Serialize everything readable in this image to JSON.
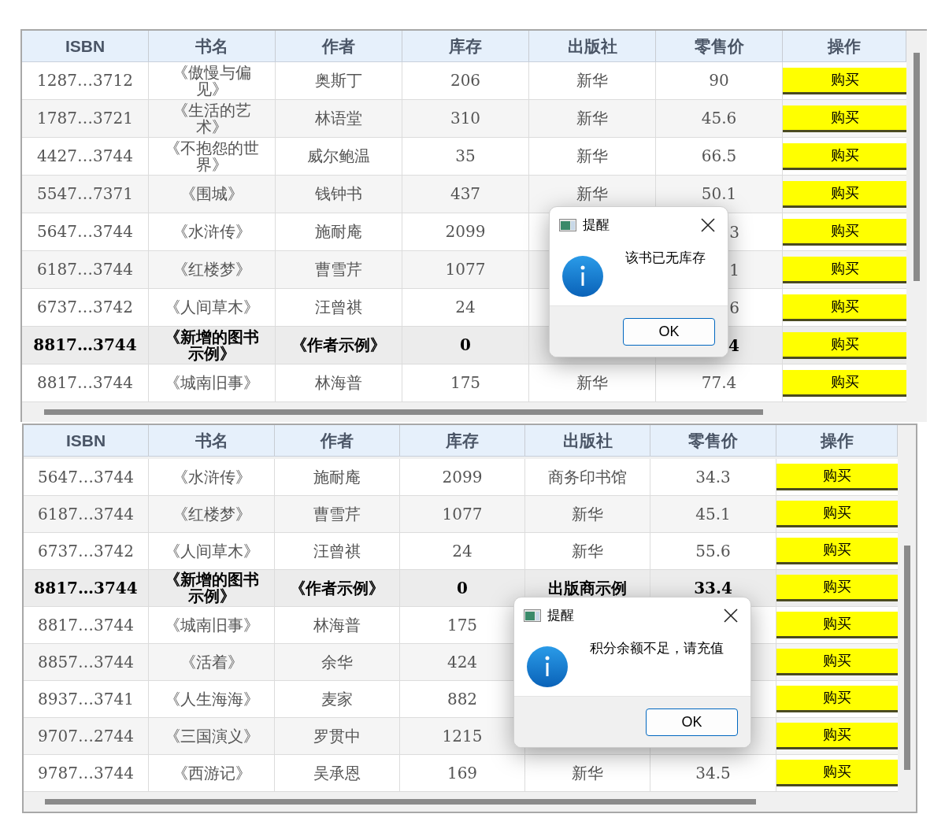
{
  "panels": [
    {
      "columns": [
        "ISBN",
        "书名",
        "作者",
        "库存",
        "出版社",
        "零售价",
        "操作"
      ],
      "rows": [
        {
          "isbn": "1287…3712",
          "title": "《傲慢与偏见》",
          "author": "奥斯丁",
          "stock": "206",
          "publisher": "新华",
          "price": "90",
          "button": "购买",
          "selected": false
        },
        {
          "isbn": "1787…3721",
          "title": "《生活的艺术》",
          "author": "林语堂",
          "stock": "310",
          "publisher": "新华",
          "price": "45.6",
          "button": "购买",
          "selected": false
        },
        {
          "isbn": "4427…3744",
          "title": "《不抱怨的世界》",
          "author": "威尔鲍温",
          "stock": "35",
          "publisher": "新华",
          "price": "66.5",
          "button": "购买",
          "selected": false
        },
        {
          "isbn": "5547…7371",
          "title": "《围城》",
          "author": "钱钟书",
          "stock": "437",
          "publisher": "新华",
          "price": "50.1",
          "button": "购买",
          "selected": false
        },
        {
          "isbn": "5647…3744",
          "title": "《水浒传》",
          "author": "施耐庵",
          "stock": "2099",
          "price": "3",
          "covered": true,
          "button": "购买",
          "selected": false
        },
        {
          "isbn": "6187…3744",
          "title": "《红楼梦》",
          "author": "曹雪芹",
          "stock": "1077",
          "price": "1",
          "covered": true,
          "button": "购买",
          "selected": false
        },
        {
          "isbn": "6737…3742",
          "title": "《人间草木》",
          "author": "汪曾祺",
          "stock": "24",
          "price": "6",
          "covered": true,
          "button": "购买",
          "selected": false
        },
        {
          "isbn": "8817…3744",
          "title": "《新增的图书示例》",
          "author": "《作者示例》",
          "stock": "0",
          "price": "4",
          "covered": true,
          "button": "购买",
          "selected": true
        },
        {
          "isbn": "8817…3744",
          "title": "《城南旧事》",
          "author": "林海普",
          "stock": "175",
          "publisher": "新华",
          "price": "77.4",
          "button": "购买",
          "selected": false
        }
      ],
      "dialog": {
        "title": "提醒",
        "message": "该书已无库存",
        "ok": "OK"
      }
    },
    {
      "columns": [
        "ISBN",
        "书名",
        "作者",
        "库存",
        "出版社",
        "零售价",
        "操作"
      ],
      "rows": [
        {
          "isbn": "5647…3744",
          "title": "《水浒传》",
          "author": "施耐庵",
          "stock": "2099",
          "publisher": "商务印书馆",
          "price": "34.3",
          "button": "购买",
          "selected": false
        },
        {
          "isbn": "6187…3744",
          "title": "《红楼梦》",
          "author": "曹雪芹",
          "stock": "1077",
          "publisher": "新华",
          "price": "45.1",
          "button": "购买",
          "selected": false
        },
        {
          "isbn": "6737…3742",
          "title": "《人间草木》",
          "author": "汪曾祺",
          "stock": "24",
          "publisher": "新华",
          "price": "55.6",
          "button": "购买",
          "selected": false
        },
        {
          "isbn": "8817…3744",
          "title": "《新增的图书示例》",
          "author": "《作者示例》",
          "stock": "0",
          "publisher": "出版商示例",
          "price": "33.4",
          "button": "购买",
          "selected": true
        },
        {
          "isbn": "8817…3744",
          "title": "《城南旧事》",
          "author": "林海普",
          "stock": "175",
          "button": "购买",
          "selected": false
        },
        {
          "isbn": "8857…3744",
          "title": "《活着》",
          "author": "余华",
          "stock": "424",
          "button": "购买",
          "selected": false
        },
        {
          "isbn": "8937…3741",
          "title": "《人生海海》",
          "author": "麦家",
          "stock": "882",
          "button": "购买",
          "selected": false
        },
        {
          "isbn": "9707…2744",
          "title": "《三国演义》",
          "author": "罗贯中",
          "stock": "1215",
          "button": "购买",
          "selected": false
        },
        {
          "isbn": "9787…3744",
          "title": "《西游记》",
          "author": "吴承恩",
          "stock": "169",
          "publisher": "新华",
          "price": "34.5",
          "button": "购买",
          "selected": false
        }
      ],
      "dialog": {
        "title": "提醒",
        "message": "积分余额不足，请充值",
        "ok": "OK"
      }
    }
  ]
}
